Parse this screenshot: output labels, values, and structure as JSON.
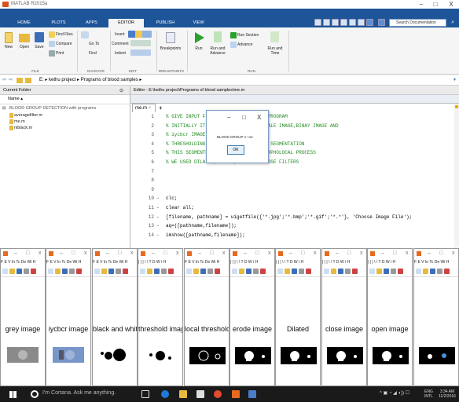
{
  "window": {
    "title": "MATLAB R2015a"
  },
  "tabs": [
    {
      "label": "HOME"
    },
    {
      "label": "PLOTS"
    },
    {
      "label": "APPS"
    },
    {
      "label": "EDITOR"
    },
    {
      "label": "PUBLISH"
    },
    {
      "label": "VIEW"
    }
  ],
  "search": {
    "placeholder": "Search Documentation"
  },
  "toolstrip": {
    "new": "New",
    "open": "Open",
    "save": "Save",
    "find_files": "Find Files",
    "compare": "Compare",
    "print": "Print",
    "go_to": "Go To",
    "find": "Find",
    "insert": "Insert",
    "comment": "Comment",
    "indent": "Indent",
    "breakpoints": "Breakpoints",
    "run": "Run",
    "run_and_advance": "Run and Advance",
    "run_section": "Run Section",
    "advance": "Advance",
    "run_and_time": "Run and Time",
    "sections": {
      "file": "FILE",
      "navigate": "NAVIGATE",
      "edit": "EDIT",
      "breakpoints": "BREAKPOINTS",
      "run": "RUN"
    }
  },
  "breadcrumb": "E: ▸ kethu project ▸ Programs of blood samples ▸",
  "current_folder": {
    "title": "Current Folder",
    "name_col": "Name ▴",
    "items": [
      {
        "label": "BLOOD GROUP DETECTION with programs"
      },
      {
        "label": "averagefilter.m"
      },
      {
        "label": "me.m"
      },
      {
        "label": "niblack.m"
      }
    ]
  },
  "editor": {
    "title": "Editor - E:\\kethu project\\Programs of blood samples\\me.m",
    "tab": "me.m",
    "lines": [
      {
        "n": "1",
        "m": "",
        "text": "% GIVE INPUT FILE AFTER RUNNING THE PROGRAM",
        "cls": "cmt"
      },
      {
        "n": "2",
        "m": "",
        "text": "% INITIALLY IT CONVERTS INTO GREY SCALE IMAGE,BINAY IMAGE AND",
        "cls": "cmt"
      },
      {
        "n": "3",
        "m": "",
        "text": "% iycbcr IMAGE",
        "cls": "cmt"
      },
      {
        "n": "4",
        "m": "",
        "text": "% THRESHOLDING TECHNIQUE IS USED FOR SEGMENTATION",
        "cls": "cmt"
      },
      {
        "n": "5",
        "m": "",
        "text": "% THIS SEGMENTED IMAGE IS SENT TO MORPHOLOCAL PROCESS",
        "cls": "cmt"
      },
      {
        "n": "6",
        "m": "",
        "text": "% WE USED DILATE ,ERODE ,OPEN AND CLOSE FILTERS",
        "cls": "cmt"
      },
      {
        "n": "7",
        "m": "",
        "text": "",
        "cls": ""
      },
      {
        "n": "8",
        "m": "",
        "text": "",
        "cls": ""
      },
      {
        "n": "9",
        "m": "",
        "text": "",
        "cls": ""
      },
      {
        "n": "10",
        "m": "–",
        "text": "clc;",
        "cls": ""
      },
      {
        "n": "11",
        "m": "–",
        "text": "clear all;",
        "cls": ""
      },
      {
        "n": "12",
        "m": "–",
        "text": "[filename, pathname] = uigetfile({'*.jpg';'*.bmp';'*.gif';'*.*'}, 'Choose Image File');",
        "cls": ""
      },
      {
        "n": "13",
        "m": "–",
        "text": "aq=([pathname,filename]);",
        "cls": ""
      },
      {
        "n": "14",
        "m": "–",
        "text": "imshow([pathname,filename]);",
        "cls": ""
      }
    ]
  },
  "dialog": {
    "message": "BLOOD GROUP A +ve",
    "ok": "OK",
    "minimize": "–",
    "maximize": "□",
    "close": "X"
  },
  "figures": [
    {
      "label": "grey image",
      "menu": "F E V In Tc De Wi H",
      "img": "grey"
    },
    {
      "label": "iycbcr image",
      "menu": "F E V In Tc De Wi H",
      "img": "ycbcr"
    },
    {
      "label": "black and white image",
      "menu": "F E V In Tc De Wi H",
      "img": "bw"
    },
    {
      "label": "threshold image",
      "menu": "| | | \\ \\ T D W i H",
      "img": "thr"
    },
    {
      "label": "local threshold image",
      "menu": "F E V In Tc De Wi H",
      "img": "local"
    },
    {
      "label": "erode image",
      "menu": "| | | \\ \\ T D W i H",
      "img": "dil"
    },
    {
      "label": "Dilated",
      "menu": "| | | \\ \\ T D W i H",
      "img": "dil"
    },
    {
      "label": "close image",
      "menu": "| | | \\ \\ T D W i H",
      "img": "dil"
    },
    {
      "label": "open image",
      "menu": "| | | \\ \\ T D W i H",
      "img": "dil"
    },
    {
      "label": "",
      "menu": "F E V In Tc De Wi H",
      "img": "last"
    }
  ],
  "taskbar": {
    "cortana": "I'm Cortana. Ask me anything.",
    "lang": "ENG",
    "region": "INTL",
    "time": "3:34 AM",
    "date": "11/2/2016"
  },
  "colors": {
    "ribbon": "#1e5598",
    "taskbar": "#1a1a1a",
    "comment": "#228b22",
    "string": "#a020f0"
  }
}
